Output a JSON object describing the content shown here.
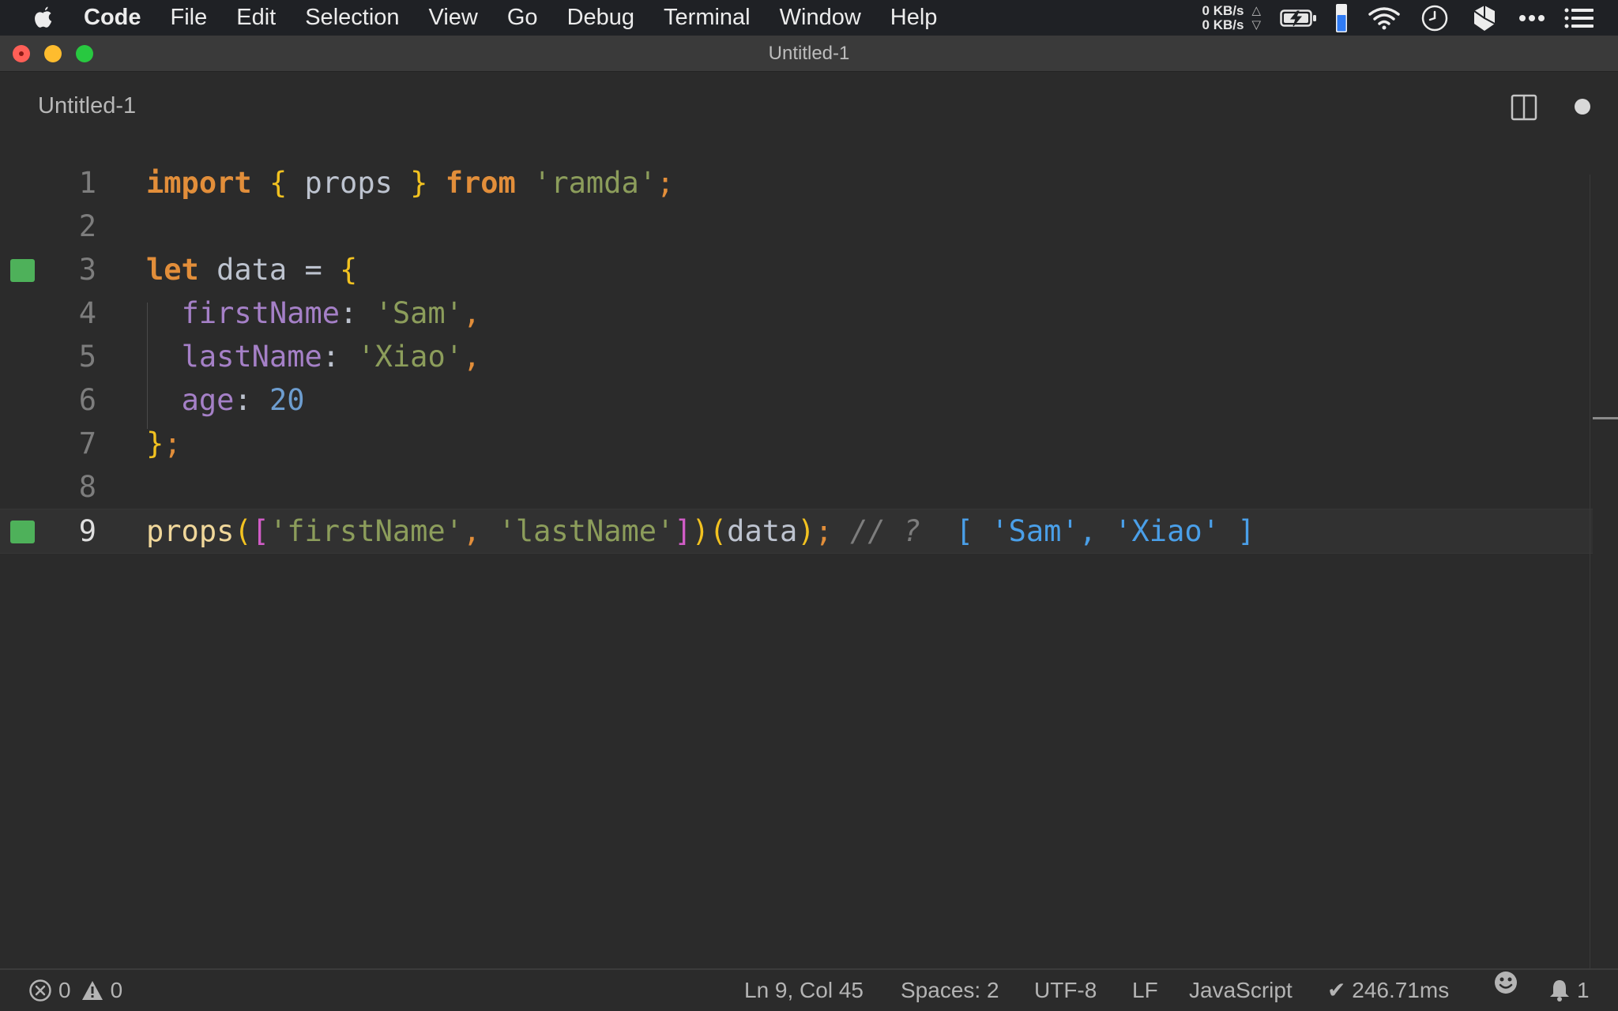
{
  "menubar": {
    "app_name": "Code",
    "items": [
      "File",
      "Edit",
      "Selection",
      "View",
      "Go",
      "Debug",
      "Terminal",
      "Window",
      "Help"
    ],
    "net_up": "0 KB/s",
    "net_down": "0 KB/s",
    "net_up_arrow": "△",
    "net_down_arrow": "▽",
    "status_icons": [
      "battery-charging-icon",
      "battery-level-icon",
      "wifi-icon",
      "time-machine-icon",
      "dropbox-icon",
      "more-icon",
      "list-icon"
    ]
  },
  "window": {
    "title": "Untitled-1"
  },
  "tab": {
    "label": "Untitled-1"
  },
  "editor": {
    "line_numbers": [
      "1",
      "2",
      "3",
      "4",
      "5",
      "6",
      "7",
      "8",
      "9"
    ],
    "active_line": 9,
    "markers": [
      3,
      9
    ],
    "lines": [
      [
        {
          "t": "import",
          "c": "kw"
        },
        {
          "t": " ",
          "c": "ident"
        },
        {
          "t": "{",
          "c": "brace"
        },
        {
          "t": " props ",
          "c": "ident"
        },
        {
          "t": "}",
          "c": "brace"
        },
        {
          "t": " ",
          "c": "ident"
        },
        {
          "t": "from",
          "c": "kw"
        },
        {
          "t": " ",
          "c": "ident"
        },
        {
          "t": "'ramda'",
          "c": "str"
        },
        {
          "t": ";",
          "c": "semi"
        }
      ],
      [],
      [
        {
          "t": "let",
          "c": "kw"
        },
        {
          "t": " data = ",
          "c": "ident"
        },
        {
          "t": "{",
          "c": "brace"
        }
      ],
      [
        {
          "t": "  ",
          "c": "ident"
        },
        {
          "t": "firstName",
          "c": "prop"
        },
        {
          "t": ": ",
          "c": "punc"
        },
        {
          "t": "'Sam'",
          "c": "str"
        },
        {
          "t": ",",
          "c": "semi"
        }
      ],
      [
        {
          "t": "  ",
          "c": "ident"
        },
        {
          "t": "lastName",
          "c": "prop"
        },
        {
          "t": ": ",
          "c": "punc"
        },
        {
          "t": "'Xiao'",
          "c": "str"
        },
        {
          "t": ",",
          "c": "semi"
        }
      ],
      [
        {
          "t": "  ",
          "c": "ident"
        },
        {
          "t": "age",
          "c": "prop"
        },
        {
          "t": ": ",
          "c": "punc"
        },
        {
          "t": "20",
          "c": "num"
        }
      ],
      [
        {
          "t": "}",
          "c": "brace"
        },
        {
          "t": ";",
          "c": "semi"
        }
      ],
      [],
      [
        {
          "t": "props",
          "c": "fn"
        },
        {
          "t": "(",
          "c": "paren"
        },
        {
          "t": "[",
          "c": "bracket"
        },
        {
          "t": "'firstName'",
          "c": "str"
        },
        {
          "t": ", ",
          "c": "semi"
        },
        {
          "t": "'lastName'",
          "c": "str"
        },
        {
          "t": "]",
          "c": "bracket"
        },
        {
          "t": ")",
          "c": "paren"
        },
        {
          "t": "(",
          "c": "paren"
        },
        {
          "t": "data",
          "c": "ident"
        },
        {
          "t": ")",
          "c": "paren"
        },
        {
          "t": ";",
          "c": "semi"
        },
        {
          "t": " // ? ",
          "c": "comment"
        },
        {
          "t": " [ 'Sam', 'Xiao' ]",
          "c": "result"
        }
      ]
    ]
  },
  "statusbar": {
    "errors": "0",
    "warnings": "0",
    "cursor": "Ln 9, Col 45",
    "spaces": "Spaces: 2",
    "encoding": "UTF-8",
    "eol": "LF",
    "language": "JavaScript",
    "quokka": "✔ 246.71ms",
    "notifications": "1"
  },
  "colors": {
    "keyword": "#e28e3a",
    "string": "#8c9d5b",
    "property": "#a580c7",
    "number": "#6d9dcf",
    "result": "#4a9fe8",
    "marker": "#4eb15a"
  }
}
